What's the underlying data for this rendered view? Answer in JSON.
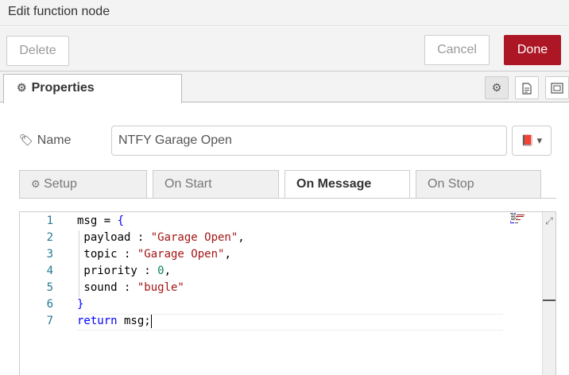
{
  "dialog": {
    "title": "Edit function node"
  },
  "toolbar": {
    "delete_label": "Delete",
    "cancel_label": "Cancel",
    "done_label": "Done",
    "done_color": "#ad1625"
  },
  "tabs": {
    "properties_label": "Properties"
  },
  "tray_icons": [
    "gear-icon",
    "document-icon",
    "layout-icon"
  ],
  "name_field": {
    "label": "Name",
    "value": "NTFY Garage Open"
  },
  "sub_tabs": [
    {
      "label": "Setup",
      "active": false
    },
    {
      "label": "On Start",
      "active": false
    },
    {
      "label": "On Message",
      "active": true
    },
    {
      "label": "On Stop",
      "active": false
    }
  ],
  "editor": {
    "line_numbers": [
      "1",
      "2",
      "3",
      "4",
      "5",
      "6",
      "7"
    ],
    "lines": [
      {
        "parts": [
          [
            "",
            "msg = "
          ],
          [
            "kw",
            "{"
          ]
        ]
      },
      {
        "parts": [
          [
            "",
            " payload : "
          ],
          [
            "str",
            "\"Garage Open\""
          ],
          [
            "",
            ","
          ]
        ]
      },
      {
        "parts": [
          [
            "",
            " topic : "
          ],
          [
            "str",
            "\"Garage Open\""
          ],
          [
            "",
            ","
          ]
        ]
      },
      {
        "parts": [
          [
            "",
            " priority : "
          ],
          [
            "num",
            "0"
          ],
          [
            "",
            ","
          ]
        ]
      },
      {
        "parts": [
          [
            "",
            " sound : "
          ],
          [
            "str",
            "\"bugle\""
          ]
        ]
      },
      {
        "parts": [
          [
            "kw",
            "}"
          ]
        ]
      },
      {
        "parts": [
          [
            "kw",
            "return"
          ],
          [
            "",
            " msg;"
          ]
        ]
      }
    ]
  }
}
